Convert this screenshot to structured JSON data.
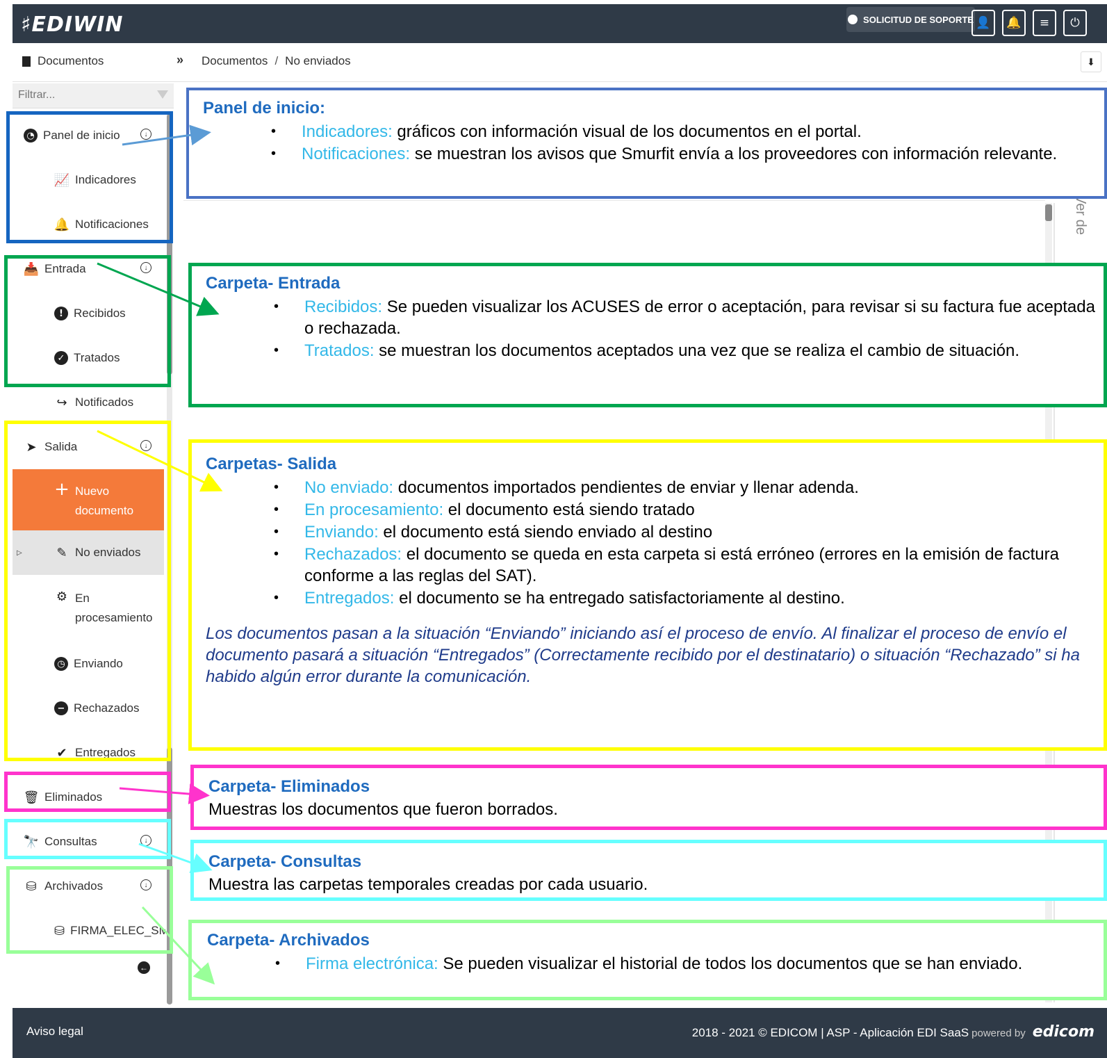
{
  "header": {
    "logo": "♯EDIWIN",
    "support_label": "SOLICITUD DE SOPORTE",
    "icons": [
      "user-icon",
      "bell-icon",
      "menu-icon",
      "power-icon"
    ]
  },
  "breadcrumb": {
    "section_label": "Documentos",
    "path": [
      "Documentos",
      "No enviados"
    ]
  },
  "sidebar": {
    "filter_placeholder": "Filtrar...",
    "items": {
      "panel": "Panel de inicio",
      "indicadores": "Indicadores",
      "notificaciones": "Notificaciones",
      "entrada": "Entrada",
      "recibidos": "Recibidos",
      "tratados": "Tratados",
      "notificados": "Notificados",
      "salida": "Salida",
      "nuevo_line1": "Nuevo",
      "nuevo_line2": "documento",
      "no_enviados": "No enviados",
      "en_line1": "En",
      "en_line2": "procesamiento",
      "enviando": "Enviando",
      "rechazados": "Rechazados",
      "entregados": "Entregados",
      "eliminados": "Eliminados",
      "consultas": "Consultas",
      "archivados": "Archivados",
      "firma": "FIRMA_ELEC_SMU"
    }
  },
  "main": {
    "side_tab": "Ver de"
  },
  "notes": {
    "panel": {
      "title": "Panel de inicio:",
      "b1_key": "Indicadores:",
      "b1_text": " gráficos con información visual de los documentos en el portal.",
      "b2_key": "Notificaciones:",
      "b2_text": " se muestran los avisos que Smurfit envía a los proveedores con información relevante."
    },
    "entrada": {
      "title": "Carpeta- Entrada",
      "b1_key": "Recibidos:",
      "b1_text": " Se pueden visualizar los ACUSES de error o aceptación, para revisar si su factura fue aceptada o rechazada.",
      "b2_key": "Tratados:",
      "b2_text": " se muestran los documentos aceptados una vez que se realiza el cambio de situación."
    },
    "salida": {
      "title": "Carpetas- Salida",
      "b1_key": "No enviado:",
      "b1_text": " documentos importados pendientes de enviar y llenar adenda.",
      "b2_key": "En procesamiento:",
      "b2_text": " el documento está siendo tratado",
      "b3_key": "Enviando:",
      "b3_text": " el documento está siendo enviado al destino",
      "b4_key": "Rechazados:",
      "b4_text": " el documento se queda en esta carpeta si está erróneo (errores en la emisión de factura conforme a las reglas del SAT).",
      "b5_key": "Entregados:",
      "b5_text": " el documento se ha entregado satisfactoriamente al destino.",
      "italic": "Los documentos pasan a la situación “Enviando” iniciando así el proceso de envío. Al finalizar el proceso de envío el documento pasará a situación “Entregados” (Correctamente recibido por el destinatario) o situación “Rechazado” si ha habido algún error durante la comunicación."
    },
    "eliminados": {
      "title": "Carpeta- Eliminados",
      "text": "Muestras los documentos que fueron borrados."
    },
    "consultas": {
      "title": "Carpeta- Consultas",
      "text": "Muestra las carpetas temporales creadas por cada usuario."
    },
    "archivados": {
      "title": "Carpeta- Archivados",
      "b1_key": "Firma electrónica:",
      "b1_text": " Se pueden visualizar el historial de todos los documentos que se han enviado."
    }
  },
  "colors": {
    "topbar": "#2f3a47",
    "accent_orange": "#f47a3a",
    "blue_frame": "#1565c0",
    "green_frame": "#00a650",
    "yellow_frame": "#ffff00",
    "magenta_frame": "#ff33cc",
    "cyan_frame": "#66ffff",
    "lightgreen_frame": "#99ff99",
    "note_title": "#1f6bbf",
    "note_key": "#33b8e8"
  },
  "footer": {
    "left": "Aviso legal",
    "right": "2018 - 2021 © EDICOM | ASP - Aplicación EDI SaaS",
    "powered": "powered by",
    "brand": "edicom"
  }
}
